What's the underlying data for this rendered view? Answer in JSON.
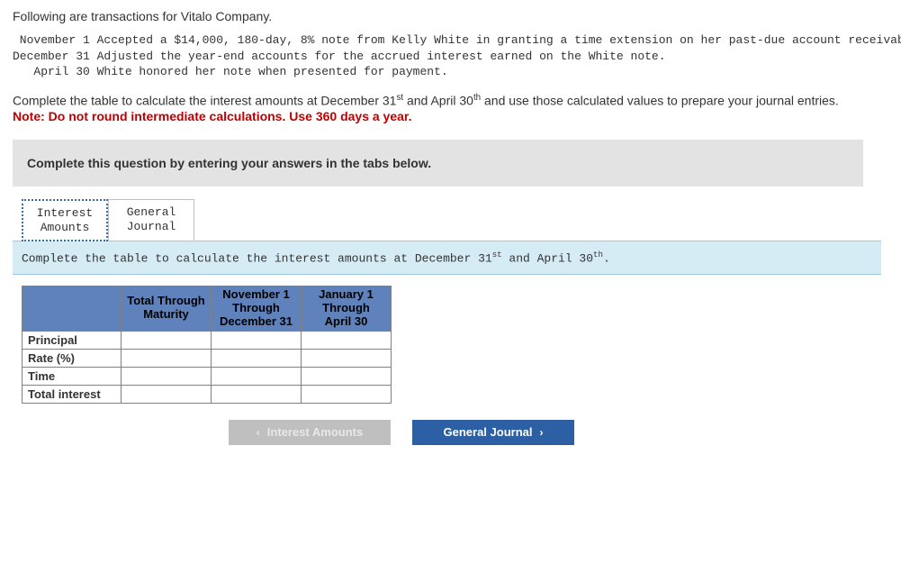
{
  "intro": "Following are transactions for Vitalo Company.",
  "transactions": " November 1 Accepted a $14,000, 180-day, 8% note from Kelly White in granting a time extension on her past-due account receivable.\nDecember 31 Adjusted the year-end accounts for the accrued interest earned on the White note.\n   April 30 White honored her note when presented for payment.",
  "instruction_pre": "Complete the table to calculate the interest amounts at December 31",
  "instruction_mid": " and April 30",
  "instruction_post": " and use those calculated values to prepare your journal entries.",
  "note": "Note: Do not round intermediate calculations. Use 360 days a year.",
  "panel_text": "Complete this question by entering your answers in the tabs below.",
  "tabs": {
    "interest": {
      "line1": "Interest",
      "line2": "Amounts"
    },
    "journal": {
      "line1": "General",
      "line2": "Journal"
    }
  },
  "sub_instr_pre": "Complete the table to calculate the interest amounts at December 31",
  "sub_instr_mid": " and April 30",
  "sub_instr_post": ".",
  "table": {
    "headers": {
      "c1": "Total Through Maturity",
      "c2a": "November 1",
      "c2b": "Through",
      "c2c": "December 31",
      "c3a": "January 1",
      "c3b": "Through",
      "c3c": "April 30"
    },
    "rows": {
      "r1": "Principal",
      "r2": "Rate (%)",
      "r3": "Time",
      "r4": "Total interest"
    },
    "cells": {
      "r1c1": "",
      "r1c2": "",
      "r1c3": "",
      "r2c1": "",
      "r2c2": "",
      "r2c3": "",
      "r3c1": "",
      "r3c2": "",
      "r3c3": "",
      "r4c1": "",
      "r4c2": "",
      "r4c3": ""
    }
  },
  "nav": {
    "prev": "Interest Amounts",
    "next": "General Journal"
  },
  "sup": {
    "st": "st",
    "th": "th"
  }
}
